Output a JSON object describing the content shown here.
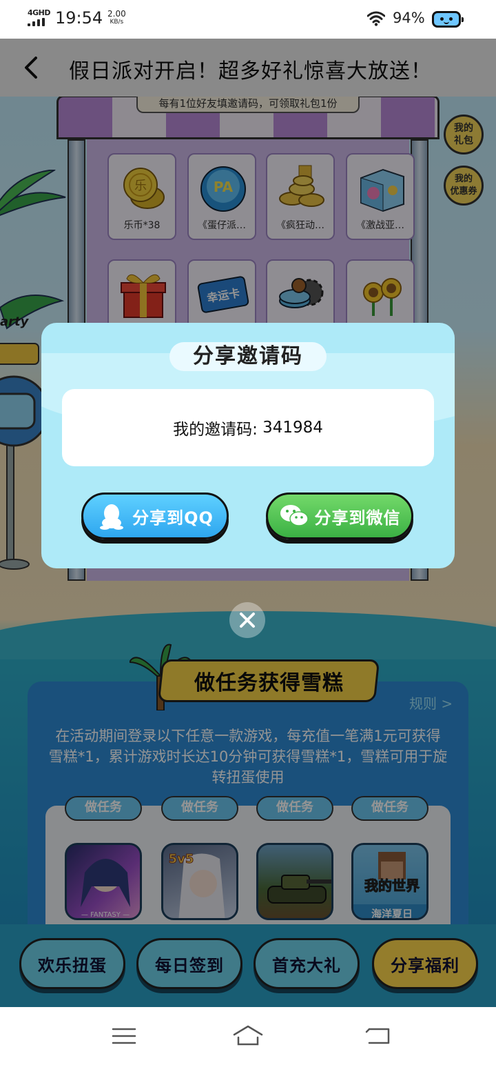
{
  "status_bar": {
    "network": "4GHD",
    "time": "19:54",
    "speed_value": "2.00",
    "speed_unit": "KB/s",
    "battery": "94%"
  },
  "header": {
    "title": "假日派对开启！超多好礼惊喜大放送！"
  },
  "booth": {
    "sign": "每有1位好友填邀请码，可领取礼包1份",
    "prizes": [
      {
        "label": "乐币*38",
        "icon": "coins-icon"
      },
      {
        "label": "《蛋仔派…",
        "icon": "bottle-cap-icon"
      },
      {
        "label": "《疯狂动…",
        "icon": "gold-stack-icon"
      },
      {
        "label": "《激战亚…",
        "icon": "gift-box-blue-icon"
      },
      {
        "label": "",
        "icon": "red-gift-icon"
      },
      {
        "label": "",
        "icon": "lucky-card-icon"
      },
      {
        "label": "",
        "icon": "gears-icon"
      },
      {
        "label": "",
        "icon": "sunflower-icon"
      }
    ],
    "lucky_card_text": "幸运卡",
    "coin_text": "乐"
  },
  "side_buttons": {
    "my_gifts": "我的\n礼包",
    "my_coupons": "我的\n优惠券"
  },
  "sign_post": {
    "text": "arty"
  },
  "dialog": {
    "title": "分享邀请码",
    "code_label": "我的邀请码: ",
    "code_value": "341984",
    "share_qq": "分享到QQ",
    "share_wechat": "分享到微信"
  },
  "quest": {
    "banner": "做任务获得雪糕",
    "rules": "规则 >",
    "description": "在活动期间登录以下任意一款游戏，每充值一笔满1元可获得雪糕*1，累计游戏时长达10分钟可获得雪糕*1，雪糕可用于旋转扭蛋使用",
    "task_label": "做任务",
    "games": [
      {
        "caption": "— FANTASY —",
        "icon": "anime-girl-game-icon"
      },
      {
        "caption": "5v5",
        "icon": "moba-hero-game-icon"
      },
      {
        "caption": "",
        "icon": "tank-game-icon"
      },
      {
        "caption": "海洋夏日",
        "title": "我的世界",
        "icon": "minecraft-game-icon"
      }
    ]
  },
  "bottom_nav": [
    {
      "label": "欢乐扭蛋",
      "active": false
    },
    {
      "label": "每日签到",
      "active": false
    },
    {
      "label": "首充大礼",
      "active": false
    },
    {
      "label": "分享福利",
      "active": true
    }
  ],
  "colors": {
    "dialog_bg": "#aeeaf8",
    "qq_button": "#3db4f5",
    "wechat_button": "#4cbf4f",
    "banner_yellow": "#f6d348",
    "overlay": "rgba(0,0,0,0.42)"
  }
}
